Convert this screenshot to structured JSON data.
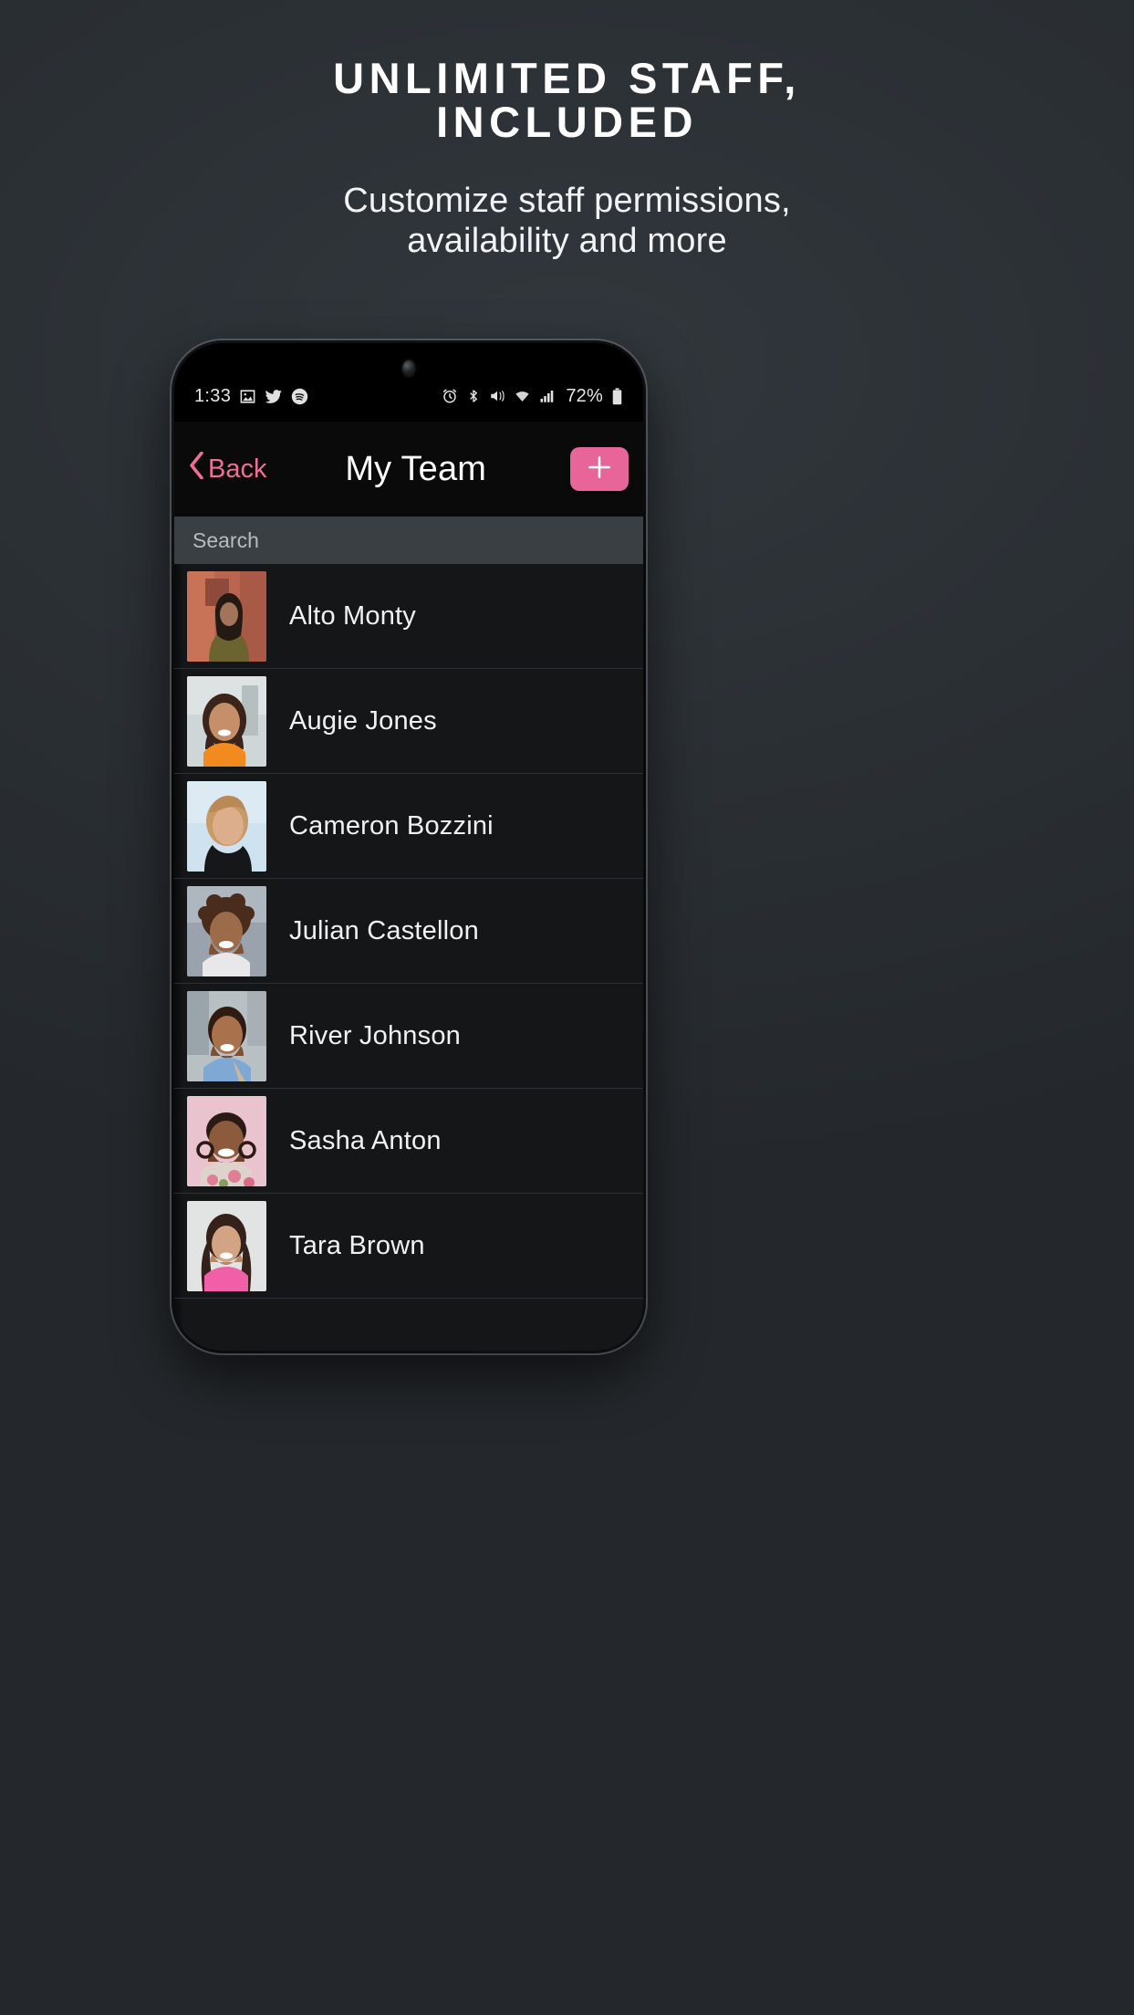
{
  "promo": {
    "title_line1": "UNLIMITED STAFF,",
    "title_line2": "INCLUDED",
    "subtitle_line1": "Customize staff permissions,",
    "subtitle_line2": "availability and more"
  },
  "colors": {
    "accent_pink": "#e8659a",
    "back_pink": "#ef6f96",
    "page_background": "#2a2f33",
    "list_background": "#141618",
    "navbar_background": "#0a0a0b",
    "search_background": "#3a3f44",
    "row_divider": "#2d3034",
    "text_primary": "#f0f1f2"
  },
  "statusbar": {
    "time": "1:33",
    "battery_percent": "72%",
    "left_icons": [
      "photo-icon",
      "twitter-icon",
      "spotify-icon"
    ],
    "right_icons": [
      "alarm-icon",
      "bluetooth-icon",
      "mute-vibrate-icon",
      "wifi-icon",
      "cellular-signal-icon",
      "battery-icon"
    ]
  },
  "navbar": {
    "back_label": "Back",
    "title": "My Team",
    "add_label": "+"
  },
  "search": {
    "placeholder": "Search",
    "value": ""
  },
  "team": {
    "members": [
      {
        "name": "Alto Monty"
      },
      {
        "name": "Augie Jones"
      },
      {
        "name": "Cameron Bozzini"
      },
      {
        "name": "Julian Castellon"
      },
      {
        "name": "River Johnson"
      },
      {
        "name": "Sasha Anton"
      },
      {
        "name": "Tara Brown"
      }
    ]
  }
}
